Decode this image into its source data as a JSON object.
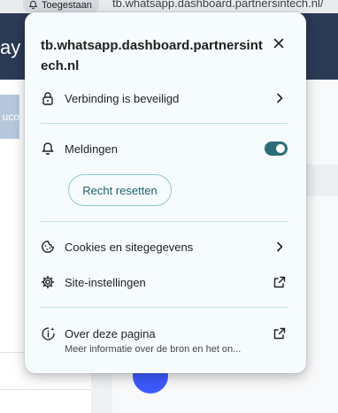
{
  "browser": {
    "permission_chip": "Toegestaan",
    "url": "tb.whatsapp.dashboard.partnersintech.nl/"
  },
  "background": {
    "header_title": "ay M",
    "left_chip_text": "uco"
  },
  "popup": {
    "site_title": "tb.whatsapp.dashboard.partnersintech.nl",
    "close_icon": "close-icon",
    "connection": {
      "label": "Verbinding is beveiligd",
      "icon": "lock-icon"
    },
    "notifications": {
      "label": "Meldingen",
      "icon": "bell-icon",
      "enabled": true,
      "reset_label": "Recht resetten"
    },
    "cookies": {
      "label": "Cookies en sitegegevens",
      "icon": "cookie-icon"
    },
    "site_settings": {
      "label": "Site-instellingen",
      "icon": "gear-icon"
    },
    "about": {
      "label": "Over deze pagina",
      "sublabel": "Meer informatie over de bron en het on...",
      "icon": "info-sparkle-icon"
    }
  },
  "colors": {
    "toggle_on": "#2a6e78",
    "popup_bg": "#f6fbfd",
    "divider": "#bfe3ea",
    "header_bg": "#2b3a55"
  }
}
